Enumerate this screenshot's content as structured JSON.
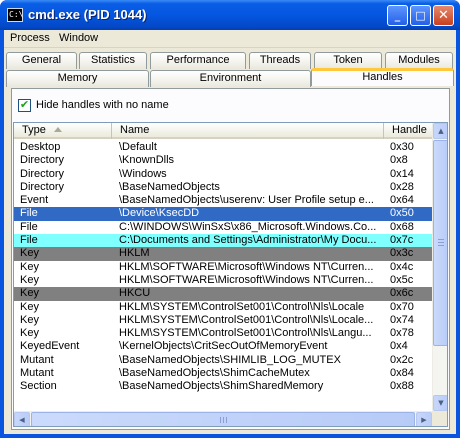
{
  "window": {
    "title": "cmd.exe (PID 1044)",
    "icon_text": "C:\\",
    "minimize_glyph": "_",
    "maximize_glyph": "□",
    "close_glyph": "✕"
  },
  "menu": {
    "items": [
      "Process",
      "Window"
    ]
  },
  "tabs": {
    "row1": [
      "General",
      "Statistics",
      "Performance",
      "Threads",
      "Token",
      "Modules"
    ],
    "row2": [
      "Memory",
      "Environment",
      "Handles"
    ],
    "active": "Handles"
  },
  "options": {
    "hide_unnamed_label": "Hide handles with no name",
    "hide_unnamed_checked": true,
    "check_glyph": "✔"
  },
  "table": {
    "columns": {
      "type": "Type",
      "name": "Name",
      "handle": "Handle"
    },
    "rows": [
      {
        "type": "Desktop",
        "name": "\\Default",
        "handle": "0x30",
        "color": ""
      },
      {
        "type": "Directory",
        "name": "\\KnownDlls",
        "handle": "0x8",
        "color": ""
      },
      {
        "type": "Directory",
        "name": "\\Windows",
        "handle": "0x14",
        "color": ""
      },
      {
        "type": "Directory",
        "name": "\\BaseNamedObjects",
        "handle": "0x28",
        "color": ""
      },
      {
        "type": "Event",
        "name": "\\BaseNamedObjects\\userenv:  User Profile setup e...",
        "handle": "0x64",
        "color": ""
      },
      {
        "type": "File",
        "name": "\\Device\\KsecDD",
        "handle": "0x50",
        "color": "#316ac5",
        "text_color": "#ffffff"
      },
      {
        "type": "File",
        "name": "C:\\WINDOWS\\WinSxS\\x86_Microsoft.Windows.Co...",
        "handle": "0x68",
        "color": ""
      },
      {
        "type": "File",
        "name": "C:\\Documents and Settings\\Administrator\\My Docu...",
        "handle": "0x7c",
        "color": "#80ffff"
      },
      {
        "type": "Key",
        "name": "HKLM",
        "handle": "0x3c",
        "color": "#808080"
      },
      {
        "type": "Key",
        "name": "HKLM\\SOFTWARE\\Microsoft\\Windows NT\\Curren...",
        "handle": "0x4c",
        "color": ""
      },
      {
        "type": "Key",
        "name": "HKLM\\SOFTWARE\\Microsoft\\Windows NT\\Curren...",
        "handle": "0x5c",
        "color": ""
      },
      {
        "type": "Key",
        "name": "HKCU",
        "handle": "0x6c",
        "color": "#808080"
      },
      {
        "type": "Key",
        "name": "HKLM\\SYSTEM\\ControlSet001\\Control\\Nls\\Locale",
        "handle": "0x70",
        "color": ""
      },
      {
        "type": "Key",
        "name": "HKLM\\SYSTEM\\ControlSet001\\Control\\Nls\\Locale...",
        "handle": "0x74",
        "color": ""
      },
      {
        "type": "Key",
        "name": "HKLM\\SYSTEM\\ControlSet001\\Control\\Nls\\Langu...",
        "handle": "0x78",
        "color": ""
      },
      {
        "type": "KeyedEvent",
        "name": "\\KernelObjects\\CritSecOutOfMemoryEvent",
        "handle": "0x4",
        "color": ""
      },
      {
        "type": "Mutant",
        "name": "\\BaseNamedObjects\\SHIMLIB_LOG_MUTEX",
        "handle": "0x2c",
        "color": ""
      },
      {
        "type": "Mutant",
        "name": "\\BaseNamedObjects\\ShimCacheMutex",
        "handle": "0x84",
        "color": ""
      },
      {
        "type": "Section",
        "name": "\\BaseNamedObjects\\ShimSharedMemory",
        "handle": "0x88",
        "color": ""
      }
    ]
  },
  "scrollbars": {
    "up_glyph": "▲",
    "down_glyph": "▼",
    "left_glyph": "◀",
    "right_glyph": "▶"
  }
}
